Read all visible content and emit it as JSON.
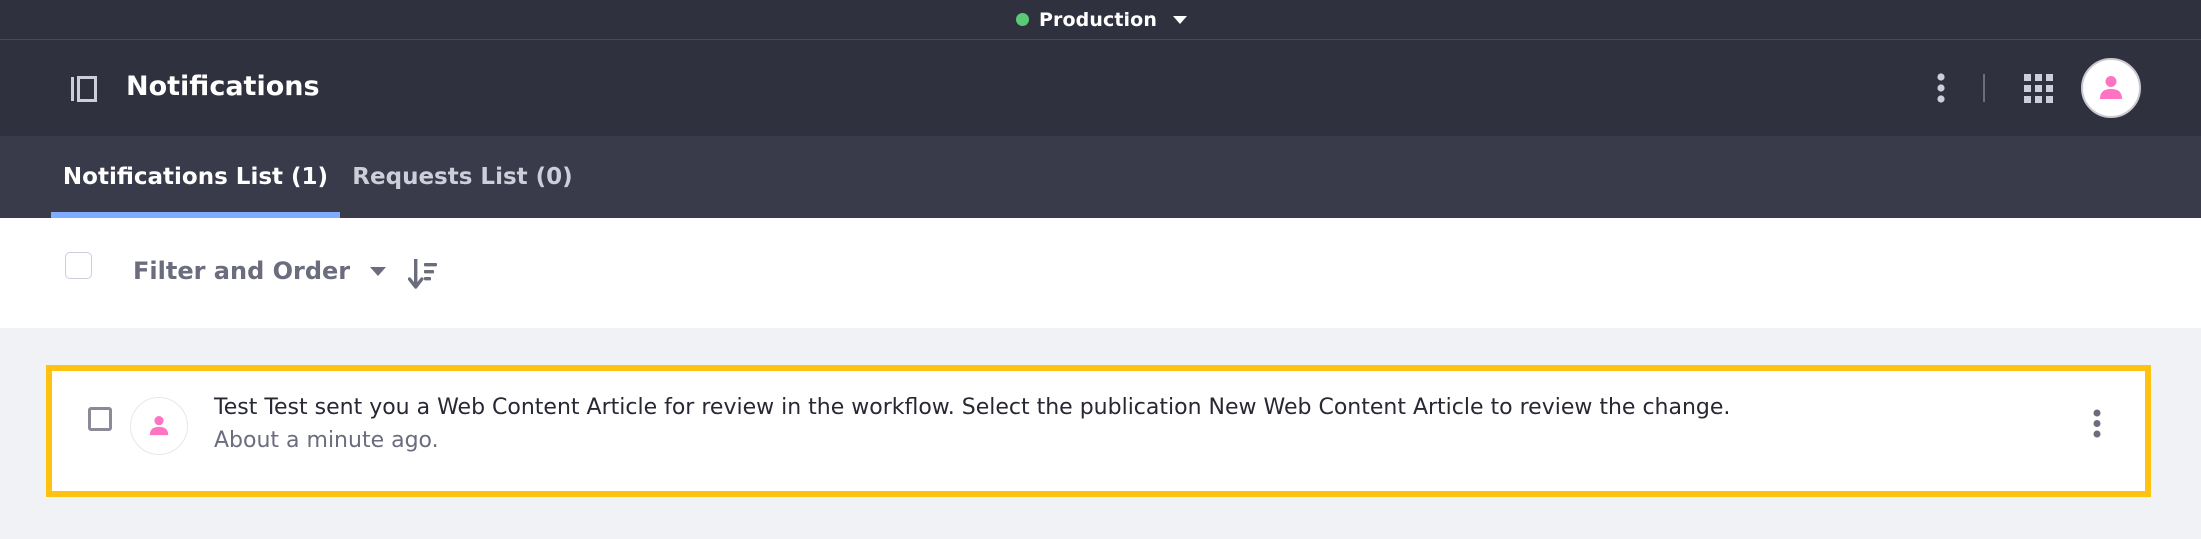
{
  "environment": {
    "label": "Production",
    "status_color": "#5aca75",
    "dropdown_icon": "caret-down-icon"
  },
  "header": {
    "title": "Notifications",
    "sidebar_toggle_icon": "sidebar-panel-icon",
    "options_icon": "ellipsis-vertical-icon",
    "apps_icon": "grid-icon",
    "user_avatar_icon": "user-icon",
    "avatar_color": "#ff73c3"
  },
  "tabs": [
    {
      "label": "Notifications List (1)",
      "active": true
    },
    {
      "label": "Requests List (0)",
      "active": false
    }
  ],
  "toolbar": {
    "select_all_checked": false,
    "filter_label": "Filter and Order",
    "sort_icon": "order-arrow-down-icon"
  },
  "notifications": [
    {
      "message": "Test Test sent you a Web Content Article for review in the workflow. Select the publication New Web Content Article to review the change.",
      "time": "About a minute ago.",
      "checked": false,
      "avatar_icon": "user-icon",
      "highlight_color": "#ffc20e"
    }
  ],
  "colors": {
    "nav_dark": "#30313f",
    "tab_bar": "#393a4a",
    "active_tab_indicator": "#80acff",
    "page_background": "#f1f2f5"
  }
}
